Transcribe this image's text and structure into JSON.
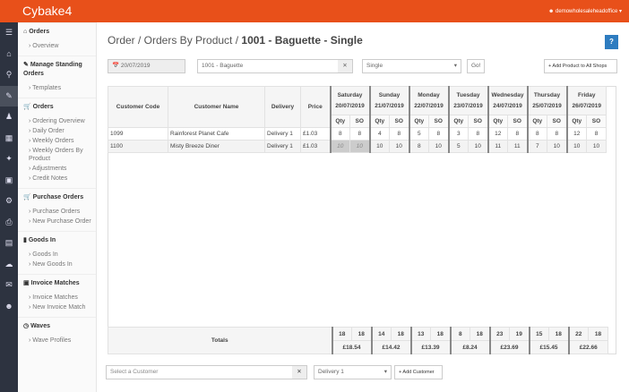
{
  "app": {
    "logo": "Cybake4",
    "user": "demowholesaleheadoffice"
  },
  "sidebar": [
    {
      "title": "Orders",
      "icon": "home-icon",
      "items": [
        "Overview"
      ]
    },
    {
      "title": "Manage Standing Orders",
      "icon": "edit-icon",
      "items": [
        "Templates"
      ]
    },
    {
      "title": "Orders",
      "icon": "cart-icon",
      "items": [
        "Ordering Overview",
        "Daily Order",
        "Weekly Orders",
        "Weekly Orders By Product",
        "Adjustments",
        "Credit Notes"
      ]
    },
    {
      "title": "Purchase Orders",
      "icon": "cart-icon",
      "items": [
        "Purchase Orders",
        "New Purchase Order"
      ]
    },
    {
      "title": "Goods In",
      "icon": "truck-icon",
      "items": [
        "Goods In",
        "New Goods In"
      ]
    },
    {
      "title": "Invoice Matches",
      "icon": "copy-icon",
      "items": [
        "Invoice Matches",
        "New Invoice Match"
      ]
    },
    {
      "title": "Waves",
      "icon": "clock-icon",
      "items": [
        "Wave Profiles"
      ]
    }
  ],
  "page": {
    "breadcrumb": "Order / Orders By Product / ",
    "title": "1001 - Baguette - Single",
    "help": "?"
  },
  "filters": {
    "date": "20/07/2019",
    "product": "1001 - Baguette",
    "type": "Single",
    "go": "Go!",
    "add_all": "+ Add Product to All Shops"
  },
  "table": {
    "headers": [
      "Customer Code",
      "Customer Name",
      "Delivery",
      "Price"
    ],
    "sub": [
      "Qty",
      "SO"
    ],
    "days": [
      {
        "day": "Saturday",
        "date": "20/07/2019"
      },
      {
        "day": "Sunday",
        "date": "21/07/2019"
      },
      {
        "day": "Monday",
        "date": "22/07/2019"
      },
      {
        "day": "Tuesday",
        "date": "23/07/2019"
      },
      {
        "day": "Wednesday",
        "date": "24/07/2019"
      },
      {
        "day": "Thursday",
        "date": "25/07/2019"
      },
      {
        "day": "Friday",
        "date": "26/07/2019"
      }
    ],
    "rows": [
      {
        "code": "1099",
        "name": "Rainforest Planet Cafe",
        "delivery": "Delivery 1",
        "price": "£1.03",
        "vals": [
          "8",
          "8",
          "4",
          "8",
          "5",
          "8",
          "3",
          "8",
          "12",
          "8",
          "8",
          "8",
          "12",
          "8"
        ]
      },
      {
        "code": "1100",
        "name": "Misty Breeze Diner",
        "delivery": "Delivery 1",
        "price": "£1.03",
        "vals": [
          "10",
          "10",
          "10",
          "10",
          "8",
          "10",
          "5",
          "10",
          "11",
          "11",
          "7",
          "10",
          "10",
          "10"
        ]
      }
    ],
    "totals_label": "Totals",
    "totals": [
      "18",
      "18",
      "14",
      "18",
      "13",
      "18",
      "8",
      "18",
      "23",
      "19",
      "15",
      "18",
      "22",
      "18"
    ],
    "total_values": [
      "£18.54",
      "£14.42",
      "£13.39",
      "£8.24",
      "£23.69",
      "£15.45",
      "£22.66"
    ]
  },
  "footer": {
    "customer_placeholder": "Select a Customer",
    "delivery": "Delivery 1",
    "add_customer": "+ Add Customer"
  }
}
